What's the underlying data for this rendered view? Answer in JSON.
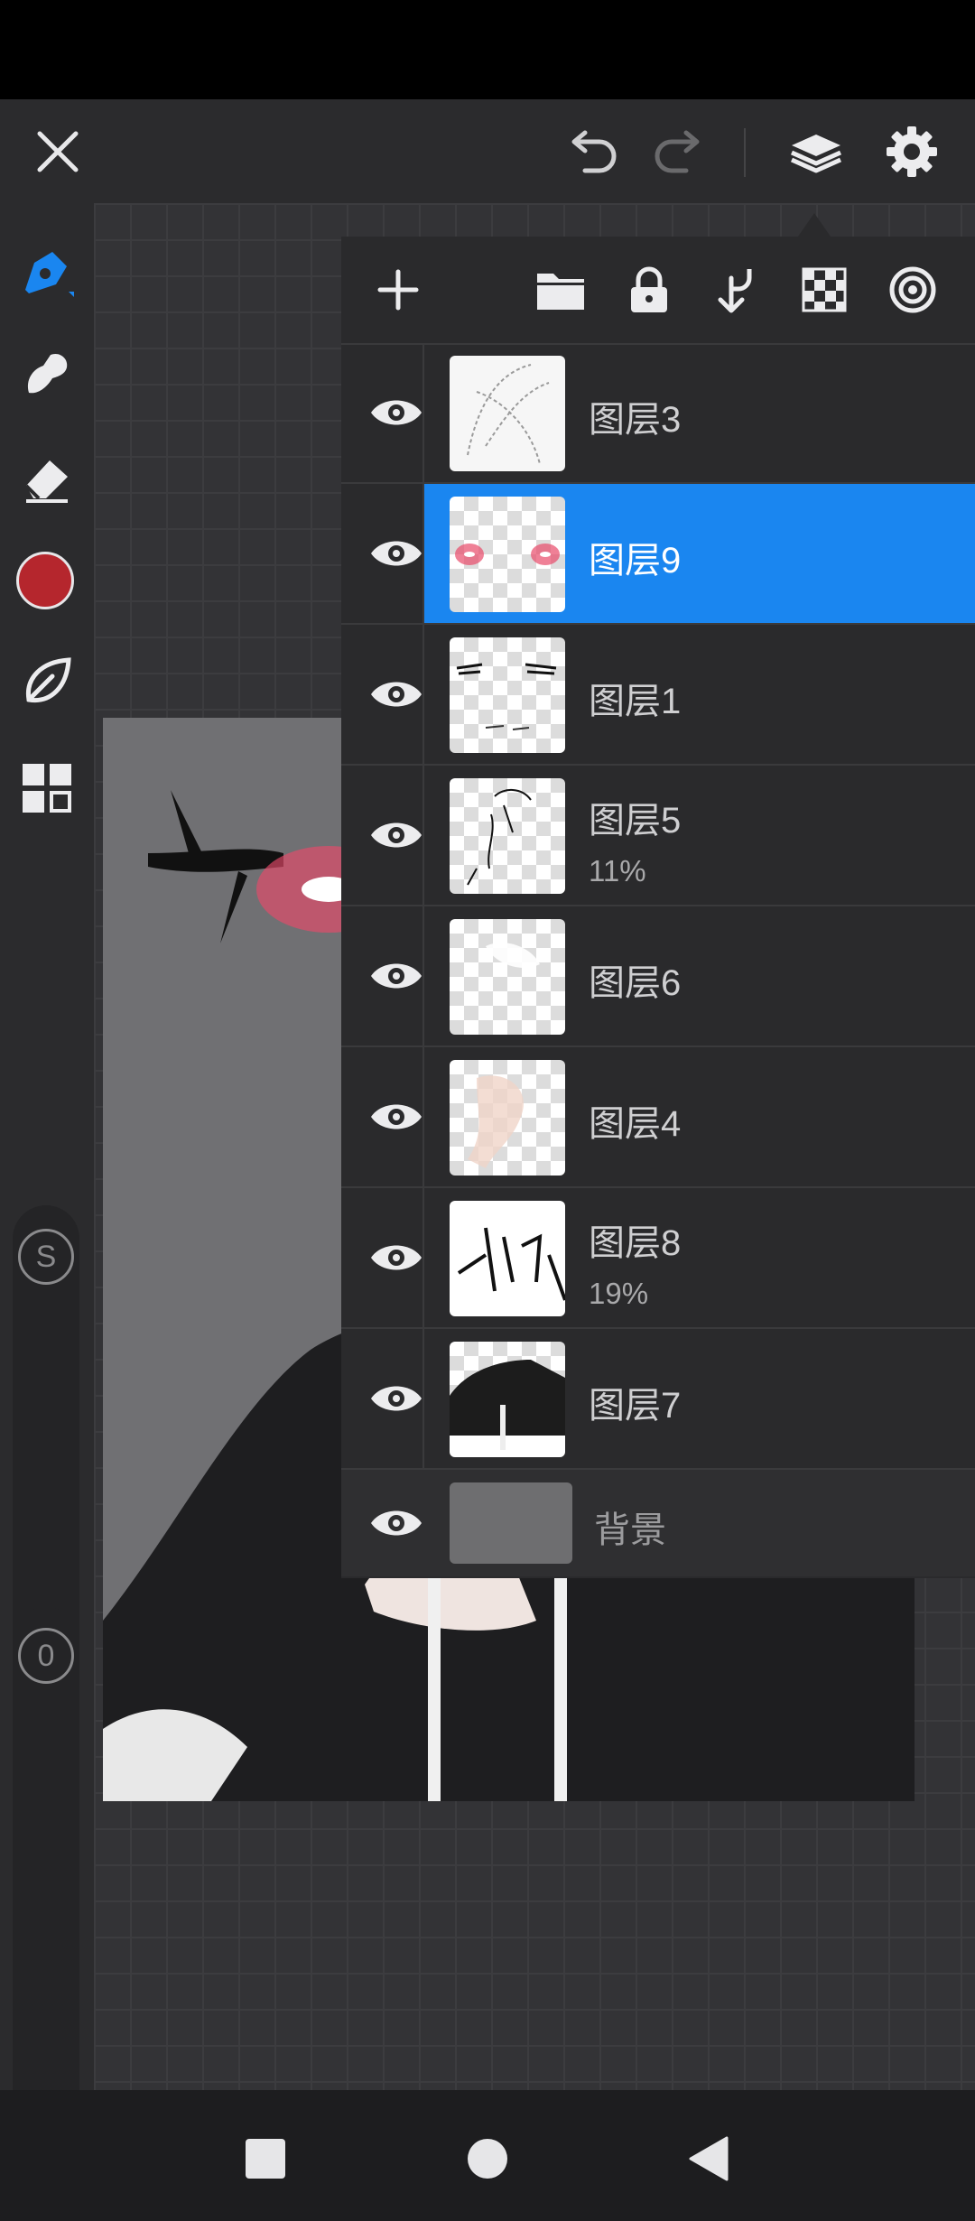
{
  "app": {
    "accent_color": "#1a86f0",
    "brush_color": "#b5262d"
  },
  "toolbar": {
    "close_icon": "close-icon",
    "undo_icon": "undo-icon",
    "redo_icon": "redo-icon",
    "layers_icon": "layers-icon",
    "settings_icon": "gear-icon"
  },
  "sidebar": {
    "tools": [
      "pen-tool-icon",
      "smudge-tool-icon",
      "eraser-tool-icon",
      "color-swatch",
      "leaf-brush-icon",
      "panels-grid-icon"
    ],
    "size_slider_label": "S",
    "opacity_slider_label": "0"
  },
  "layers_panel": {
    "toolbar_icons": [
      "add-layer-icon",
      "folder-icon",
      "lock-icon",
      "merge-down-icon",
      "transparency-icon",
      "target-icon"
    ],
    "layers": [
      {
        "name": "图层3",
        "opacity": "",
        "selected": false
      },
      {
        "name": "图层9",
        "opacity": "",
        "selected": true
      },
      {
        "name": "图层1",
        "opacity": "",
        "selected": false
      },
      {
        "name": "图层5",
        "opacity": "11%",
        "selected": false
      },
      {
        "name": "图层6",
        "opacity": "",
        "selected": false
      },
      {
        "name": "图层4",
        "opacity": "",
        "selected": false
      },
      {
        "name": "图层8",
        "opacity": "19%",
        "selected": false
      },
      {
        "name": "图层7",
        "opacity": "",
        "selected": false
      }
    ],
    "background": {
      "name": "背景"
    }
  },
  "navbar": {
    "recents_icon": "square-icon",
    "home_icon": "circle-icon",
    "back_icon": "triangle-back-icon"
  }
}
